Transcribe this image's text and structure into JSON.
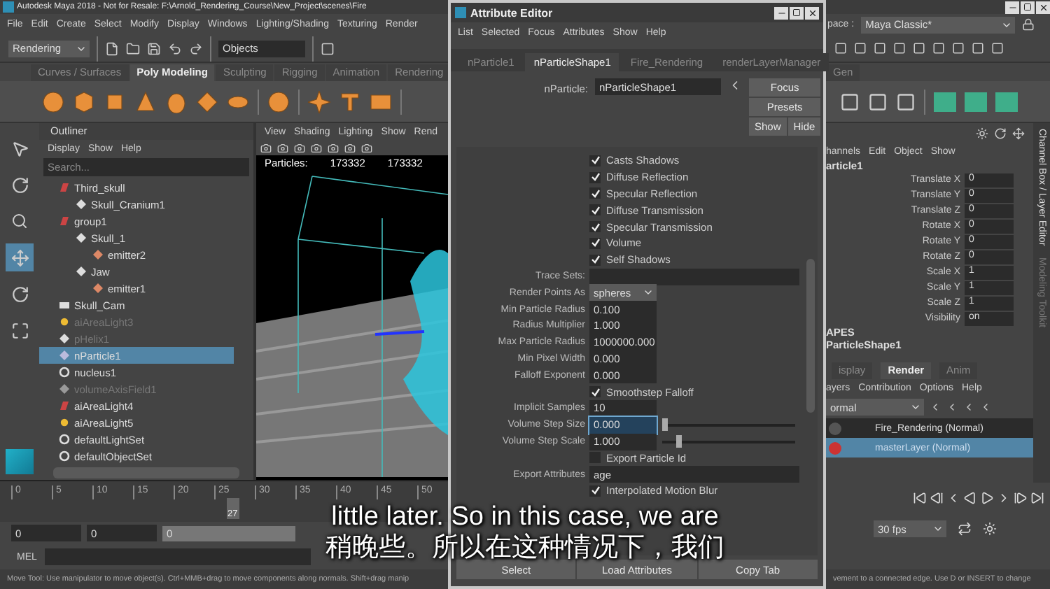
{
  "main_window": {
    "title": "Autodesk Maya 2018 - Not for Resale: F:\\Arnold_Rendering_Course\\New_Project\\scenes\\Fire",
    "menu": [
      "File",
      "Edit",
      "Create",
      "Select",
      "Modify",
      "Display",
      "Windows",
      "Lighting/Shading",
      "Texturing",
      "Render"
    ],
    "workspace_label": "pace :",
    "workspace": "Maya Classic*"
  },
  "status_line": {
    "menu_set": "Rendering",
    "selection_mode": "Objects"
  },
  "shelf": {
    "tabs": [
      {
        "label": "Curves / Surfaces",
        "selected": false
      },
      {
        "label": "Poly Modeling",
        "selected": true
      },
      {
        "label": "Sculpting",
        "selected": false
      },
      {
        "label": "Rigging",
        "selected": false
      },
      {
        "label": "Animation",
        "selected": false
      },
      {
        "label": "Rendering",
        "selected": false
      }
    ],
    "right_tab": "Gen"
  },
  "outliner": {
    "title": "Outliner",
    "menu": [
      "Display",
      "Show",
      "Help"
    ],
    "search_placeholder": "Search...",
    "items": [
      {
        "label": "Third_skull",
        "kind": "group",
        "selected": false,
        "hidden": false,
        "children": [
          {
            "label": "Skull_Cranium1",
            "kind": "mesh",
            "selected": false,
            "hidden": false
          }
        ]
      },
      {
        "label": "group1",
        "kind": "group",
        "selected": false,
        "hidden": false,
        "children": [
          {
            "label": "Skull_1",
            "kind": "mesh",
            "selected": false,
            "hidden": false,
            "children": [
              {
                "label": "emitter2",
                "kind": "emitter",
                "selected": false,
                "hidden": false
              }
            ]
          },
          {
            "label": "Jaw",
            "kind": "mesh",
            "selected": false,
            "hidden": false,
            "children": [
              {
                "label": "emitter1",
                "kind": "emitter",
                "selected": false,
                "hidden": false
              }
            ]
          }
        ]
      },
      {
        "label": "Skull_Cam",
        "kind": "camera",
        "selected": false,
        "hidden": false
      },
      {
        "label": "aiAreaLight3",
        "kind": "light",
        "selected": false,
        "hidden": true
      },
      {
        "label": "pHelix1",
        "kind": "mesh",
        "selected": false,
        "hidden": true
      },
      {
        "label": "nParticle1",
        "kind": "particle",
        "selected": true,
        "hidden": false
      },
      {
        "label": "nucleus1",
        "kind": "nucleus",
        "selected": false,
        "hidden": false
      },
      {
        "label": "volumeAxisField1",
        "kind": "field",
        "selected": false,
        "hidden": true
      },
      {
        "label": "aiAreaLight4",
        "kind": "group",
        "selected": false,
        "hidden": false
      },
      {
        "label": "aiAreaLight5",
        "kind": "light",
        "selected": false,
        "hidden": false
      },
      {
        "label": "defaultLightSet",
        "kind": "set",
        "selected": false,
        "hidden": false
      },
      {
        "label": "defaultObjectSet",
        "kind": "set",
        "selected": false,
        "hidden": false
      }
    ]
  },
  "viewport": {
    "menu": [
      "View",
      "Shading",
      "Lighting",
      "Show",
      "Rend"
    ],
    "hud_label": "Particles:",
    "hud_values": [
      "173332",
      "173332"
    ]
  },
  "timeline": {
    "ticks": [
      "0",
      "5",
      "10",
      "15",
      "20",
      "25",
      "30",
      "35",
      "40",
      "45",
      "50"
    ],
    "current": "27"
  },
  "range": {
    "start": "0",
    "anim_start": "0",
    "playback_start": "0"
  },
  "command_line": {
    "label": "MEL"
  },
  "help_line": {
    "left": "Move Tool: Use manipulator to move object(s). Ctrl+MMB+drag to move components along normals. Shift+drag manip",
    "right": "vement to a connected edge. Use D or INSERT to change"
  },
  "attribute_editor": {
    "title": "Attribute Editor",
    "menu": [
      "List",
      "Selected",
      "Focus",
      "Attributes",
      "Show",
      "Help"
    ],
    "tabs": [
      {
        "label": "nParticle1",
        "selected": false
      },
      {
        "label": "nParticleShape1",
        "selected": true
      },
      {
        "label": "Fire_Rendering",
        "selected": false
      },
      {
        "label": "renderLayerManager",
        "selected": false
      }
    ],
    "node_label": "nParticle:",
    "node_value": "nParticleShape1",
    "buttons": [
      "Focus",
      "Presets",
      "Show",
      "Hide"
    ],
    "attributes": [
      {
        "kind": "checkbox",
        "label": "Casts Shadows",
        "checked": true
      },
      {
        "kind": "checkbox",
        "label": "Diffuse Reflection",
        "checked": true
      },
      {
        "kind": "checkbox",
        "label": "Specular Reflection",
        "checked": true
      },
      {
        "kind": "checkbox",
        "label": "Diffuse Transmission",
        "checked": true
      },
      {
        "kind": "checkbox",
        "label": "Specular Transmission",
        "checked": true
      },
      {
        "kind": "checkbox",
        "label": "Volume",
        "checked": true
      },
      {
        "kind": "checkbox",
        "label": "Self Shadows",
        "checked": true
      },
      {
        "kind": "text",
        "label": "Trace Sets:"
      },
      {
        "kind": "dropdown",
        "label": "Render Points As",
        "value": "spheres"
      },
      {
        "kind": "number",
        "label": "Min Particle Radius",
        "value": "0.100"
      },
      {
        "kind": "number",
        "label": "Radius Multiplier",
        "value": "1.000"
      },
      {
        "kind": "number",
        "label": "Max Particle Radius",
        "value": "1000000.000"
      },
      {
        "kind": "number",
        "label": "Min Pixel Width",
        "value": "0.000"
      },
      {
        "kind": "number",
        "label": "Falloff Exponent",
        "value": "0.000"
      },
      {
        "kind": "checkbox",
        "label": "Smoothstep Falloff",
        "checked": true
      },
      {
        "kind": "number",
        "label": "Implicit Samples",
        "value": "10"
      },
      {
        "kind": "slider",
        "label": "Volume Step Size",
        "value": "0.000",
        "level": 0.0,
        "focused": true
      },
      {
        "kind": "slider",
        "label": "Volume Step Scale",
        "value": "1.000",
        "level": 0.1,
        "focused": false
      },
      {
        "kind": "checkbox",
        "label": "Export Particle Id",
        "checked": false
      },
      {
        "kind": "text",
        "label": "Export Attributes",
        "value": "age"
      },
      {
        "kind": "checkbox",
        "label": "Interpolated Motion Blur",
        "checked": true
      }
    ],
    "footer_buttons": [
      "Select",
      "Load Attributes",
      "Copy Tab"
    ]
  },
  "channel_box": {
    "menu": [
      "hannels",
      "Edit",
      "Object",
      "Show"
    ],
    "node": "article1",
    "channels": [
      {
        "name": "Translate X",
        "value": "0"
      },
      {
        "name": "Translate Y",
        "value": "0"
      },
      {
        "name": "Translate Z",
        "value": "0"
      },
      {
        "name": "Rotate X",
        "value": "0"
      },
      {
        "name": "Rotate Y",
        "value": "0"
      },
      {
        "name": "Rotate Z",
        "value": "0"
      },
      {
        "name": "Scale X",
        "value": "1"
      },
      {
        "name": "Scale Y",
        "value": "1"
      },
      {
        "name": "Scale Z",
        "value": "1"
      },
      {
        "name": "Visibility",
        "value": "on"
      }
    ],
    "shapes_heading": "APES",
    "shape": "ParticleShape1"
  },
  "layer_editor": {
    "tabs": [
      {
        "label": "isplay",
        "selected": false
      },
      {
        "label": "Render",
        "selected": true
      },
      {
        "label": "Anim",
        "selected": false
      }
    ],
    "menu": [
      "ayers",
      "Contribution",
      "Options",
      "Help"
    ],
    "blend_mode": "ormal",
    "layers": [
      {
        "name": "Fire_Rendering (Normal)",
        "selected": false,
        "renderable": false
      },
      {
        "name": "masterLayer (Normal)",
        "selected": true,
        "renderable": true
      }
    ]
  },
  "playback": {
    "fps": "30 fps"
  },
  "side_tabs": [
    "Channel Box / Layer Editor",
    "Modeling Toolkit"
  ],
  "subtitles": [
    "little later. So in this case, we are",
    "稍晚些。所以在这种情况下，我们"
  ]
}
